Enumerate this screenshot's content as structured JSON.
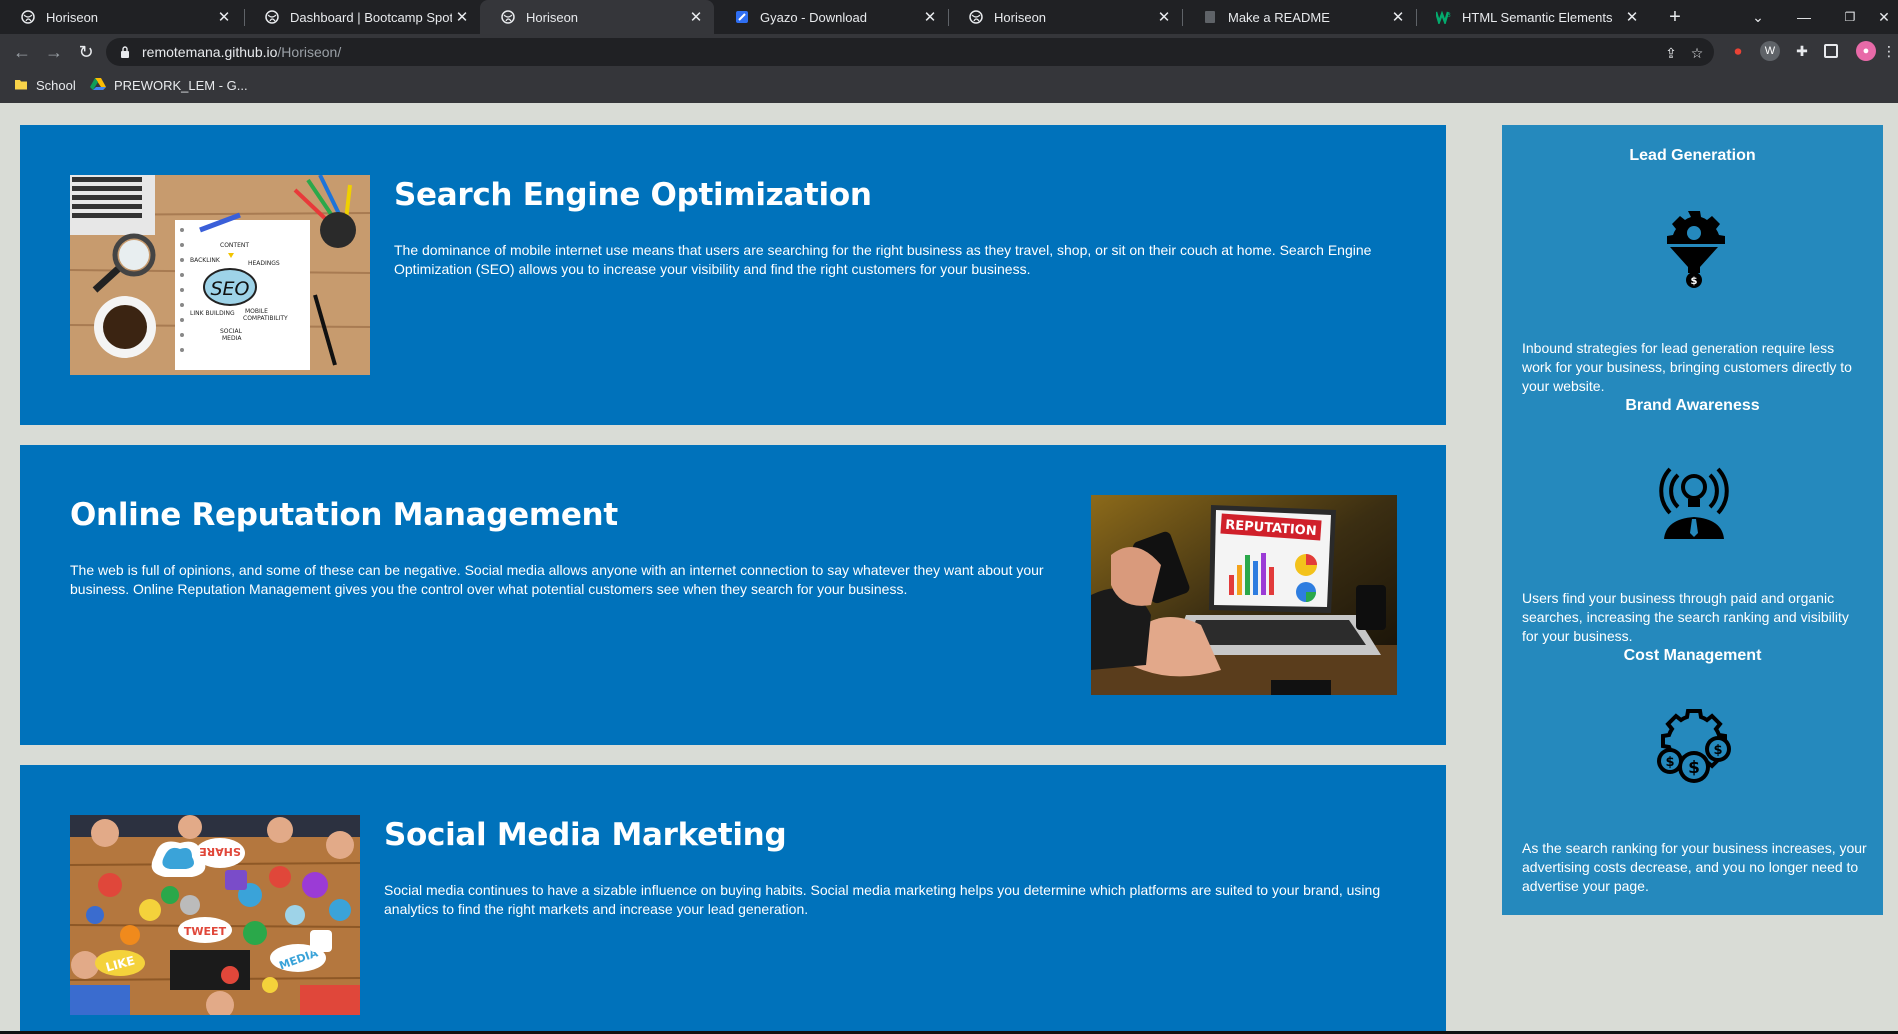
{
  "browser": {
    "tabs": [
      {
        "title": "Horiseon",
        "active": false
      },
      {
        "title": "Dashboard | Bootcamp Spot",
        "active": false
      },
      {
        "title": "Horiseon",
        "active": true
      },
      {
        "title": "Gyazo - Download",
        "active": false
      },
      {
        "title": "Horiseon",
        "active": false
      },
      {
        "title": "Make a README",
        "active": false
      },
      {
        "title": "HTML Semantic Elements",
        "active": false
      }
    ],
    "url_host": "remotemana.github.io",
    "url_path": "/Horiseon/",
    "bookmarks": [
      {
        "label": "School"
      },
      {
        "label": "PREWORK_LEM - G..."
      }
    ]
  },
  "content": {
    "sections": [
      {
        "title": "Search Engine Optimization",
        "text": "The dominance of mobile internet use means that users are searching for the right business as they travel, shop, or sit on their couch at home. Search Engine Optimization (SEO) allows you to increase your visibility and find the right customers for your business.",
        "image_text": "SEO"
      },
      {
        "title": "Online Reputation Management",
        "text": "The web is full of opinions, and some of these can be negative. Social media allows anyone with an internet connection to say whatever they want about your business. Online Reputation Management gives you the control over what potential customers see when they search for your business.",
        "image_text": "REPUTATION"
      },
      {
        "title": "Social Media Marketing",
        "text": "Social media continues to have a sizable influence on buying habits. Social media marketing helps you determine which platforms are suited to your brand, using analytics to find the right markets and increase your lead generation.",
        "image_text": [
          "SHARE",
          "TWEET",
          "LIKE",
          "MEDIA"
        ]
      }
    ]
  },
  "benefits": [
    {
      "title": "Lead Generation",
      "icon": "lead-generation-icon",
      "text": "Inbound strategies for lead generation require less work for your business, bringing customers directly to your website."
    },
    {
      "title": "Brand Awareness",
      "icon": "brand-awareness-icon",
      "text": "Users find your business through paid and organic searches, increasing the search ranking and visibility for your business."
    },
    {
      "title": "Cost Management",
      "icon": "cost-management-icon",
      "text": "As the search ranking for your business increases, your advertising costs decrease, and you no longer need to advertise your page."
    }
  ],
  "colors": {
    "page_bg": "#d9dcd6",
    "card_bg": "#0072bb",
    "aside_bg": "#2589bd",
    "text": "#ffffff"
  }
}
